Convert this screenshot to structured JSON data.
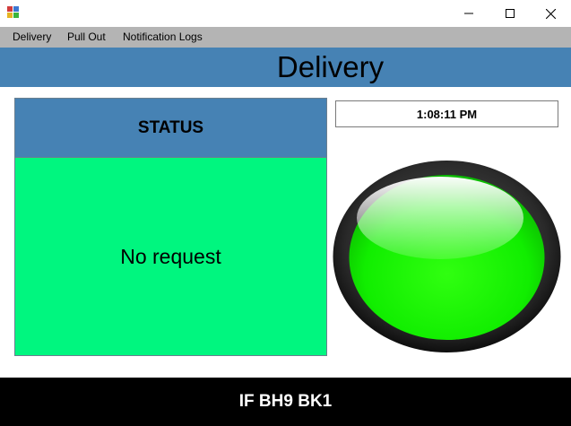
{
  "window": {
    "controls": [
      "minimize-icon",
      "maximize-icon",
      "close-icon"
    ]
  },
  "menu": {
    "items": [
      "Delivery",
      "Pull Out",
      "Notification Logs"
    ]
  },
  "header": {
    "title": "Delivery"
  },
  "status": {
    "heading": "STATUS",
    "message": "No request",
    "heading_color": "#4682b4",
    "panel_color": "#00f67f"
  },
  "clock": {
    "time": "1:08:11 PM"
  },
  "indicator": {
    "state": "green-light",
    "color": "#11ee00"
  },
  "footer": {
    "text": "IF BH9 BK1"
  }
}
